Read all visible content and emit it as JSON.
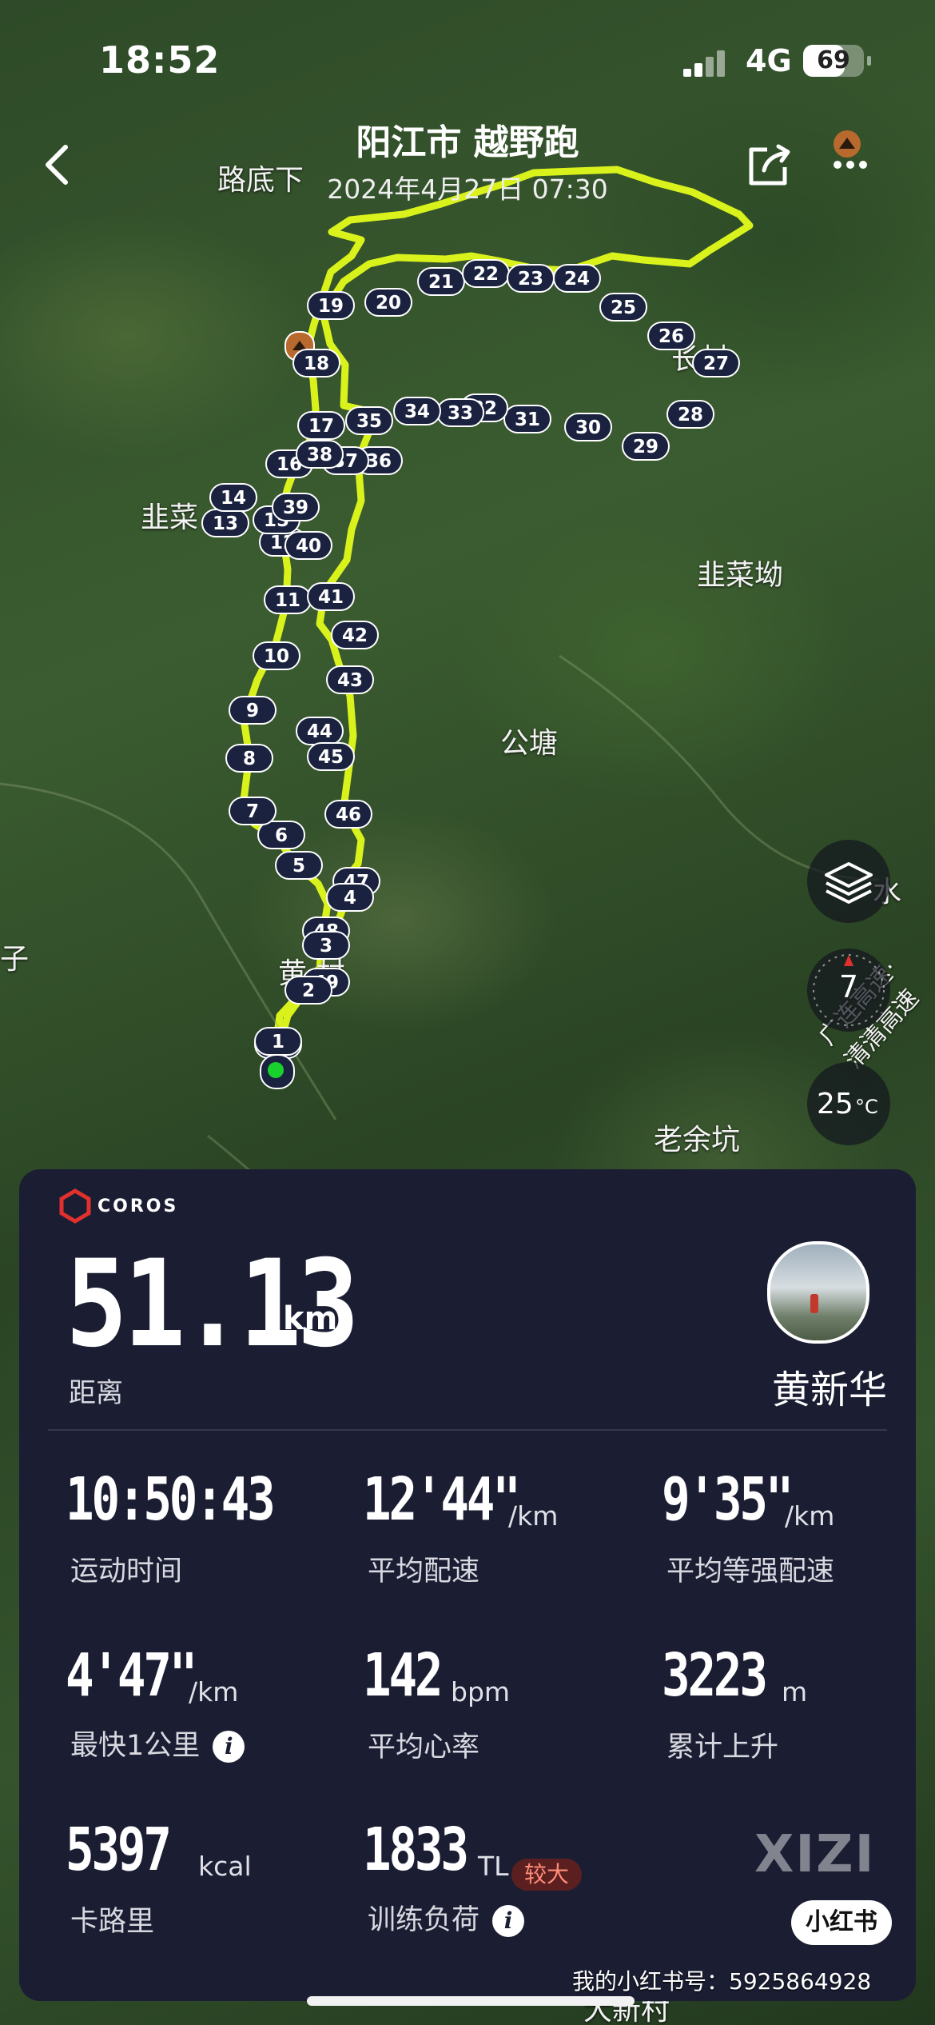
{
  "status_bar": {
    "time": "18:52",
    "network": "4G",
    "battery": "69",
    "battery_level": 0.69
  },
  "header": {
    "title": "阳江市 越野跑",
    "datetime": "2024年4月27日 07:30"
  },
  "map": {
    "place_labels": {
      "ludixia": "路底下",
      "jiucai": "韭菜",
      "jiucaiao": "韭菜坳",
      "gongtang": "公塘",
      "chang_cun": "长村",
      "huang_cun": "黄 村",
      "zi": "子",
      "laoyukeng": "老余坑",
      "road": "广连高速·清清高速",
      "dashui": "水",
      "daxinshi": "大新村"
    },
    "markers": [
      "1",
      "2",
      "3",
      "4",
      "5",
      "6",
      "7",
      "8",
      "9",
      "10",
      "11",
      "12",
      "13",
      "14",
      "15",
      "16",
      "17",
      "18",
      "19",
      "20",
      "21",
      "22",
      "23",
      "24",
      "25",
      "26",
      "27",
      "28",
      "29",
      "30",
      "31",
      "32",
      "33",
      "34",
      "35",
      "36",
      "37",
      "38",
      "39",
      "40",
      "41",
      "42",
      "43",
      "44",
      "45",
      "46",
      "47",
      "48",
      "49",
      "50"
    ],
    "compass_value": "7",
    "temperature": "25",
    "temperature_unit": "°C",
    "route_color": "#d9f21c"
  },
  "summary": {
    "brand": "COROS",
    "distance": "51.13",
    "distance_unit": "km",
    "distance_label": "距离",
    "user_name": "黄新华",
    "stats": [
      {
        "value": "10:50:43",
        "unit": "",
        "label": "运动时间"
      },
      {
        "value": "12'44\"",
        "unit": "/km",
        "label": "平均配速"
      },
      {
        "value": "9'35\"",
        "unit": "/km",
        "label": "平均等强配速"
      },
      {
        "value": "4'47\"",
        "unit": "/km",
        "label": "最快1公里"
      },
      {
        "value": "142",
        "unit": "bpm",
        "label": "平均心率"
      },
      {
        "value": "3223",
        "unit": "m",
        "label": "累计上升"
      },
      {
        "value": "5397",
        "unit": "kcal",
        "label": "卡路里"
      },
      {
        "value": "1833",
        "unit": "TL",
        "label": "训练负荷"
      }
    ],
    "load_badge": "较大",
    "watermark": "XIZI",
    "xhs_label": "小红书"
  },
  "footer": {
    "account": "我的小红书号：5925864928"
  },
  "colors": {
    "card_bg": "#1b1e33",
    "marker_bg": "#1a2240",
    "accent_red": "#e2312d",
    "route": "#d9f21c"
  }
}
